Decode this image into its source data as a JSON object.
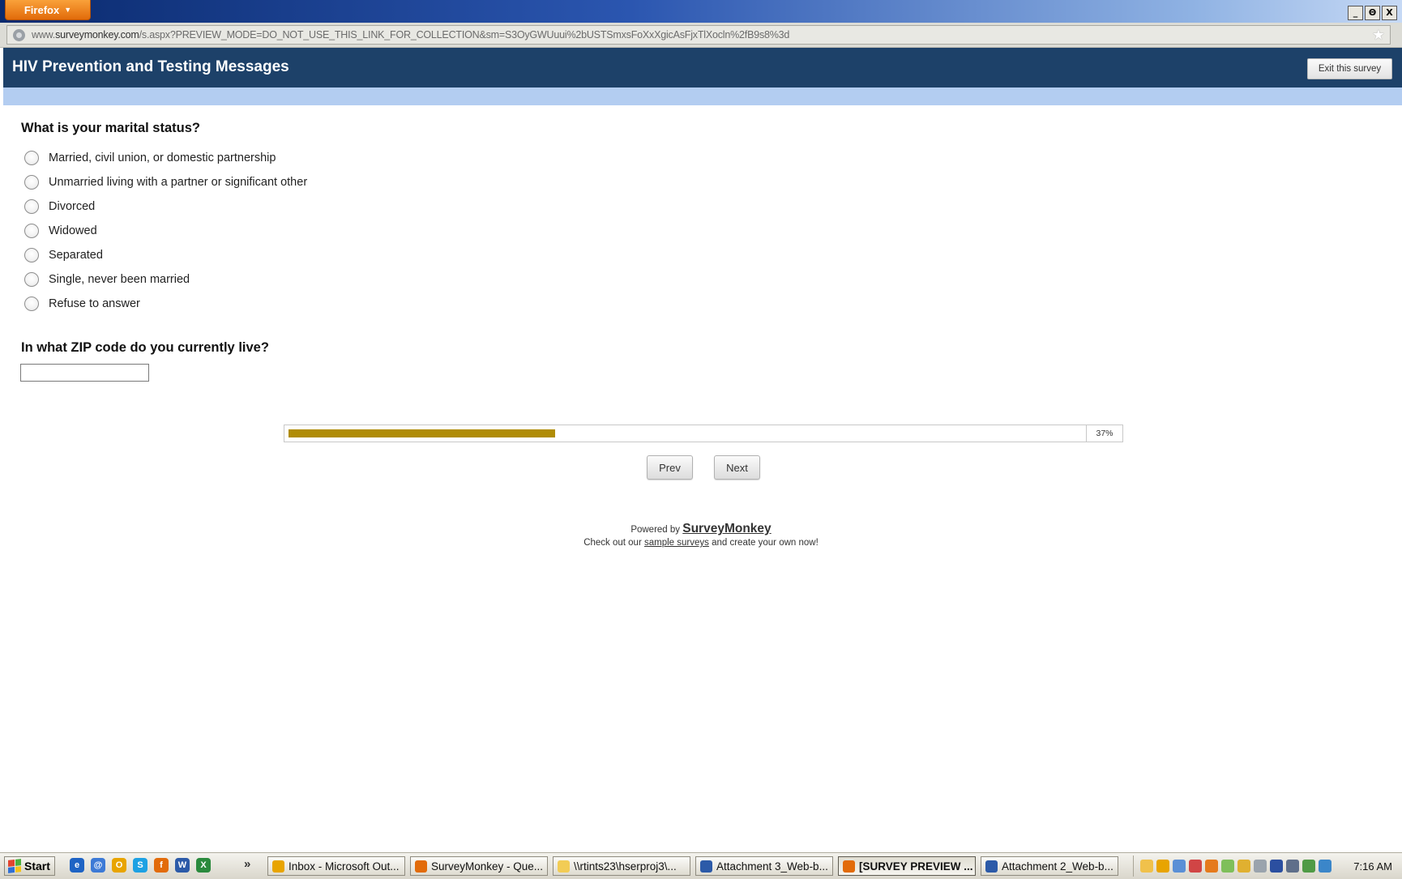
{
  "browser": {
    "app_button_label": "Firefox",
    "url_host_prefix": "www.",
    "url_host": "surveymonkey.com",
    "url_path": "/s.aspx?PREVIEW_MODE=DO_NOT_USE_THIS_LINK_FOR_COLLECTION&sm=S3OyGWUuui%2bUSTSmxsFoXxXgicAsFjxTlXocln%2fB9s8%3d",
    "window_controls": [
      "_",
      "Θ",
      "X"
    ]
  },
  "survey": {
    "title": "HIV Prevention and Testing Messages",
    "exit_label": "Exit this survey",
    "q1": {
      "text": "What is your marital status?",
      "options": [
        "Married, civil union, or domestic partnership",
        "Unmarried living with a partner or significant other",
        "Divorced",
        "Widowed",
        "Separated",
        "Single, never been married",
        "Refuse to answer"
      ]
    },
    "q2": {
      "text": "In what ZIP code do you currently live?",
      "value": ""
    },
    "progress": {
      "percent": 37,
      "label": "37%",
      "fill_color": "#b08c05"
    },
    "prev_label": "Prev",
    "next_label": "Next"
  },
  "footer": {
    "powered_by": "Powered by",
    "brand": "SurveyMonkey",
    "checkout_pre": "Check out our",
    "checkout_link": "sample surveys",
    "checkout_post": "and create your own now!"
  },
  "colors": {
    "header_bg": "#1d4169",
    "header_stripe": "#b3cdf1",
    "firefox_orange": "#e26b0a"
  },
  "taskbar": {
    "start_label": "Start",
    "quick_launch": [
      {
        "icon": "ie-icon",
        "color": "#1e63c4",
        "glyph": "e"
      },
      {
        "icon": "outlook-express-icon",
        "color": "#3d7ad6",
        "glyph": "@"
      },
      {
        "icon": "outlook-icon",
        "color": "#e8a400",
        "glyph": "O"
      },
      {
        "icon": "skype-icon",
        "color": "#1da1e3",
        "glyph": "S"
      },
      {
        "icon": "firefox-icon",
        "color": "#e26b0a",
        "glyph": "f"
      },
      {
        "icon": "word-icon",
        "color": "#2c5aa8",
        "glyph": "W"
      },
      {
        "icon": "excel-icon",
        "color": "#2a8a3d",
        "glyph": "X"
      }
    ],
    "overflow_glyph": "»",
    "tasks": [
      {
        "label": "Inbox - Microsoft Out...",
        "icon": "outlook-icon",
        "color": "#e8a400",
        "active": false
      },
      {
        "label": "SurveyMonkey - Que...",
        "icon": "firefox-icon",
        "color": "#e26b0a",
        "active": false
      },
      {
        "label": "\\\\rtints23\\hserproj3\\...",
        "icon": "folder-icon",
        "color": "#f2cc55",
        "active": false
      },
      {
        "label": "Attachment 3_Web-b...",
        "icon": "word-icon",
        "color": "#2c5aa8",
        "active": false
      },
      {
        "label": "[SURVEY PREVIEW ...",
        "icon": "firefox-icon",
        "color": "#e26b0a",
        "active": true
      },
      {
        "label": "Attachment 2_Web-b...",
        "icon": "word-icon",
        "color": "#2c5aa8",
        "active": false
      }
    ],
    "tray_icons": [
      {
        "icon": "mail-icon",
        "color": "#f0c14b"
      },
      {
        "icon": "outlook-tray-icon",
        "color": "#e8a400"
      },
      {
        "icon": "volume-icon",
        "color": "#5a8fd6"
      },
      {
        "icon": "network-error-icon",
        "color": "#d14545"
      },
      {
        "icon": "update-icon",
        "color": "#e57a1c"
      },
      {
        "icon": "display-icon",
        "color": "#7fbf5a"
      },
      {
        "icon": "lock-icon",
        "color": "#e0b030"
      },
      {
        "icon": "wireless-icon",
        "color": "#9aa3ad"
      },
      {
        "icon": "antivirus-icon",
        "color": "#2b4fa0"
      },
      {
        "icon": "monitor-icon",
        "color": "#5f6f8a"
      },
      {
        "icon": "tools-icon",
        "color": "#4f9a45"
      },
      {
        "icon": "users-icon",
        "color": "#3b86c9"
      }
    ],
    "clock": "7:16 AM"
  }
}
